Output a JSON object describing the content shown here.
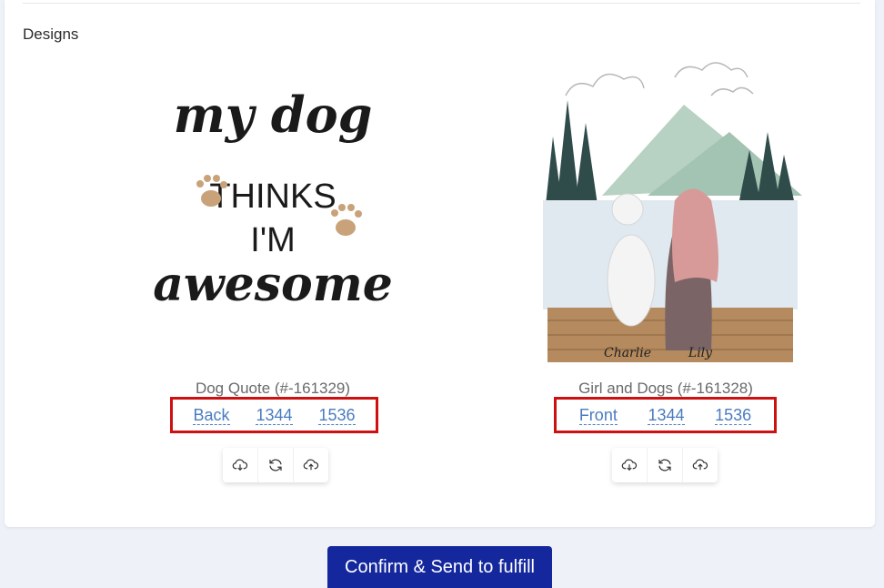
{
  "section": {
    "title": "Designs"
  },
  "designs": [
    {
      "name": "Dog Quote (#-161329)",
      "links": [
        "Back",
        "1344",
        "1536"
      ],
      "artwork_text": [
        "my dog",
        "THINKS",
        "I'M",
        "awesome"
      ]
    },
    {
      "name": "Girl and Dogs (#-161328)",
      "links": [
        "Front",
        "1344",
        "1536"
      ],
      "artwork_text": [
        "Charlie",
        "Lily"
      ]
    }
  ],
  "icons": [
    "cloud-download-icon",
    "refresh-icon",
    "cloud-upload-icon"
  ],
  "footer": {
    "confirm_label": "Confirm & Send to fulfill"
  },
  "colors": {
    "accent": "#14279c",
    "link": "#4a7cc0",
    "highlight": "#cf1010"
  }
}
